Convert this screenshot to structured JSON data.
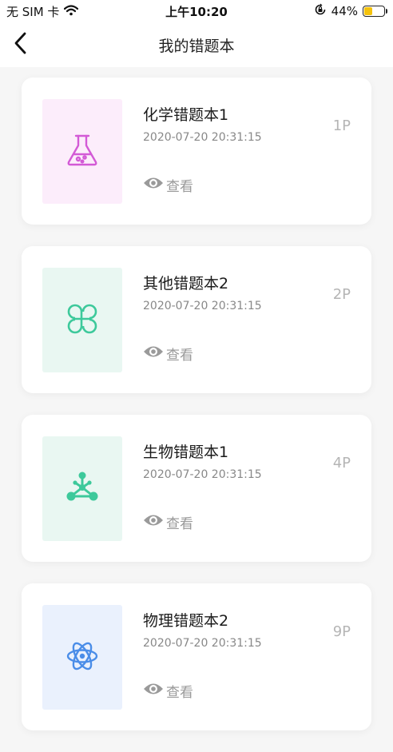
{
  "status_bar": {
    "carrier": "无 SIM 卡",
    "time": "上午10:20",
    "battery_percent": "44%",
    "battery_level": 0.44,
    "battery_color": "#f4c20d",
    "icons": [
      "wifi-icon",
      "rotation-lock-icon",
      "battery-icon"
    ]
  },
  "nav": {
    "title": "我的错题本",
    "back_icon": "chevron-left-icon"
  },
  "notebooks": [
    {
      "title": "化学错题本1",
      "time": "2020-07-20 20:31:15",
      "pages": "1P",
      "view_label": "查看",
      "icon": "flask-icon",
      "cover_bg": "#fcedfb",
      "icon_color": "#d35ad6"
    },
    {
      "title": "其他错题本2",
      "time": "2020-07-20 20:31:15",
      "pages": "2P",
      "view_label": "查看",
      "icon": "command-icon",
      "cover_bg": "#e9f7f2",
      "icon_color": "#3dc99b"
    },
    {
      "title": "生物错题本1",
      "time": "2020-07-20 20:31:15",
      "pages": "4P",
      "view_label": "查看",
      "icon": "molecule-icon",
      "cover_bg": "#e9f7f2",
      "icon_color": "#3dc99b"
    },
    {
      "title": "物理错题本2",
      "time": "2020-07-20 20:31:15",
      "pages": "9P",
      "view_label": "查看",
      "icon": "atom-icon",
      "cover_bg": "#eaf1fd",
      "icon_color": "#4a8de8"
    }
  ]
}
